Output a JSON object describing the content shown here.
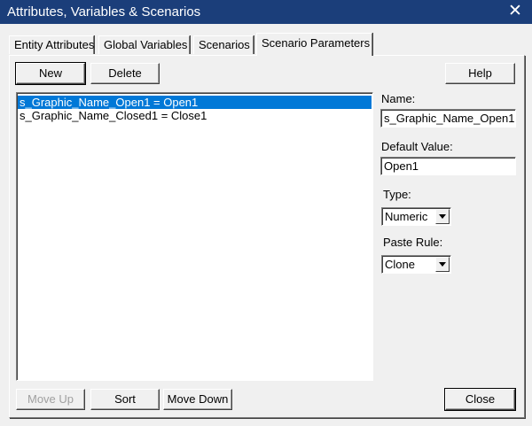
{
  "window": {
    "title": "Attributes, Variables & Scenarios",
    "close_glyph": "✕"
  },
  "tabs": [
    {
      "label": "Entity Attributes",
      "active": false
    },
    {
      "label": "Global Variables",
      "active": false
    },
    {
      "label": "Scenarios",
      "active": false
    },
    {
      "label": "Scenario Parameters",
      "active": true
    }
  ],
  "toolbar": {
    "new_label": "New",
    "delete_label": "Delete",
    "help_label": "Help"
  },
  "list": {
    "items": [
      {
        "text": "s_Graphic_Name_Open1 = Open1",
        "selected": true
      },
      {
        "text": "s_Graphic_Name_Closed1 = Close1",
        "selected": false
      }
    ]
  },
  "fields": {
    "name_label": "Name:",
    "name_value": "s_Graphic_Name_Open1",
    "default_value_label": "Default Value:",
    "default_value_value": "Open1",
    "type_label": "Type:",
    "type_value": "Numeric",
    "paste_rule_label": "Paste Rule:",
    "paste_rule_value": "Clone"
  },
  "bottom": {
    "move_up_label": "Move Up",
    "sort_label": "Sort",
    "move_down_label": "Move Down",
    "close_label": "Close"
  },
  "colors": {
    "titlebar": "#1b3e7a",
    "selection": "#0078d7",
    "face": "#f0f0f0"
  }
}
